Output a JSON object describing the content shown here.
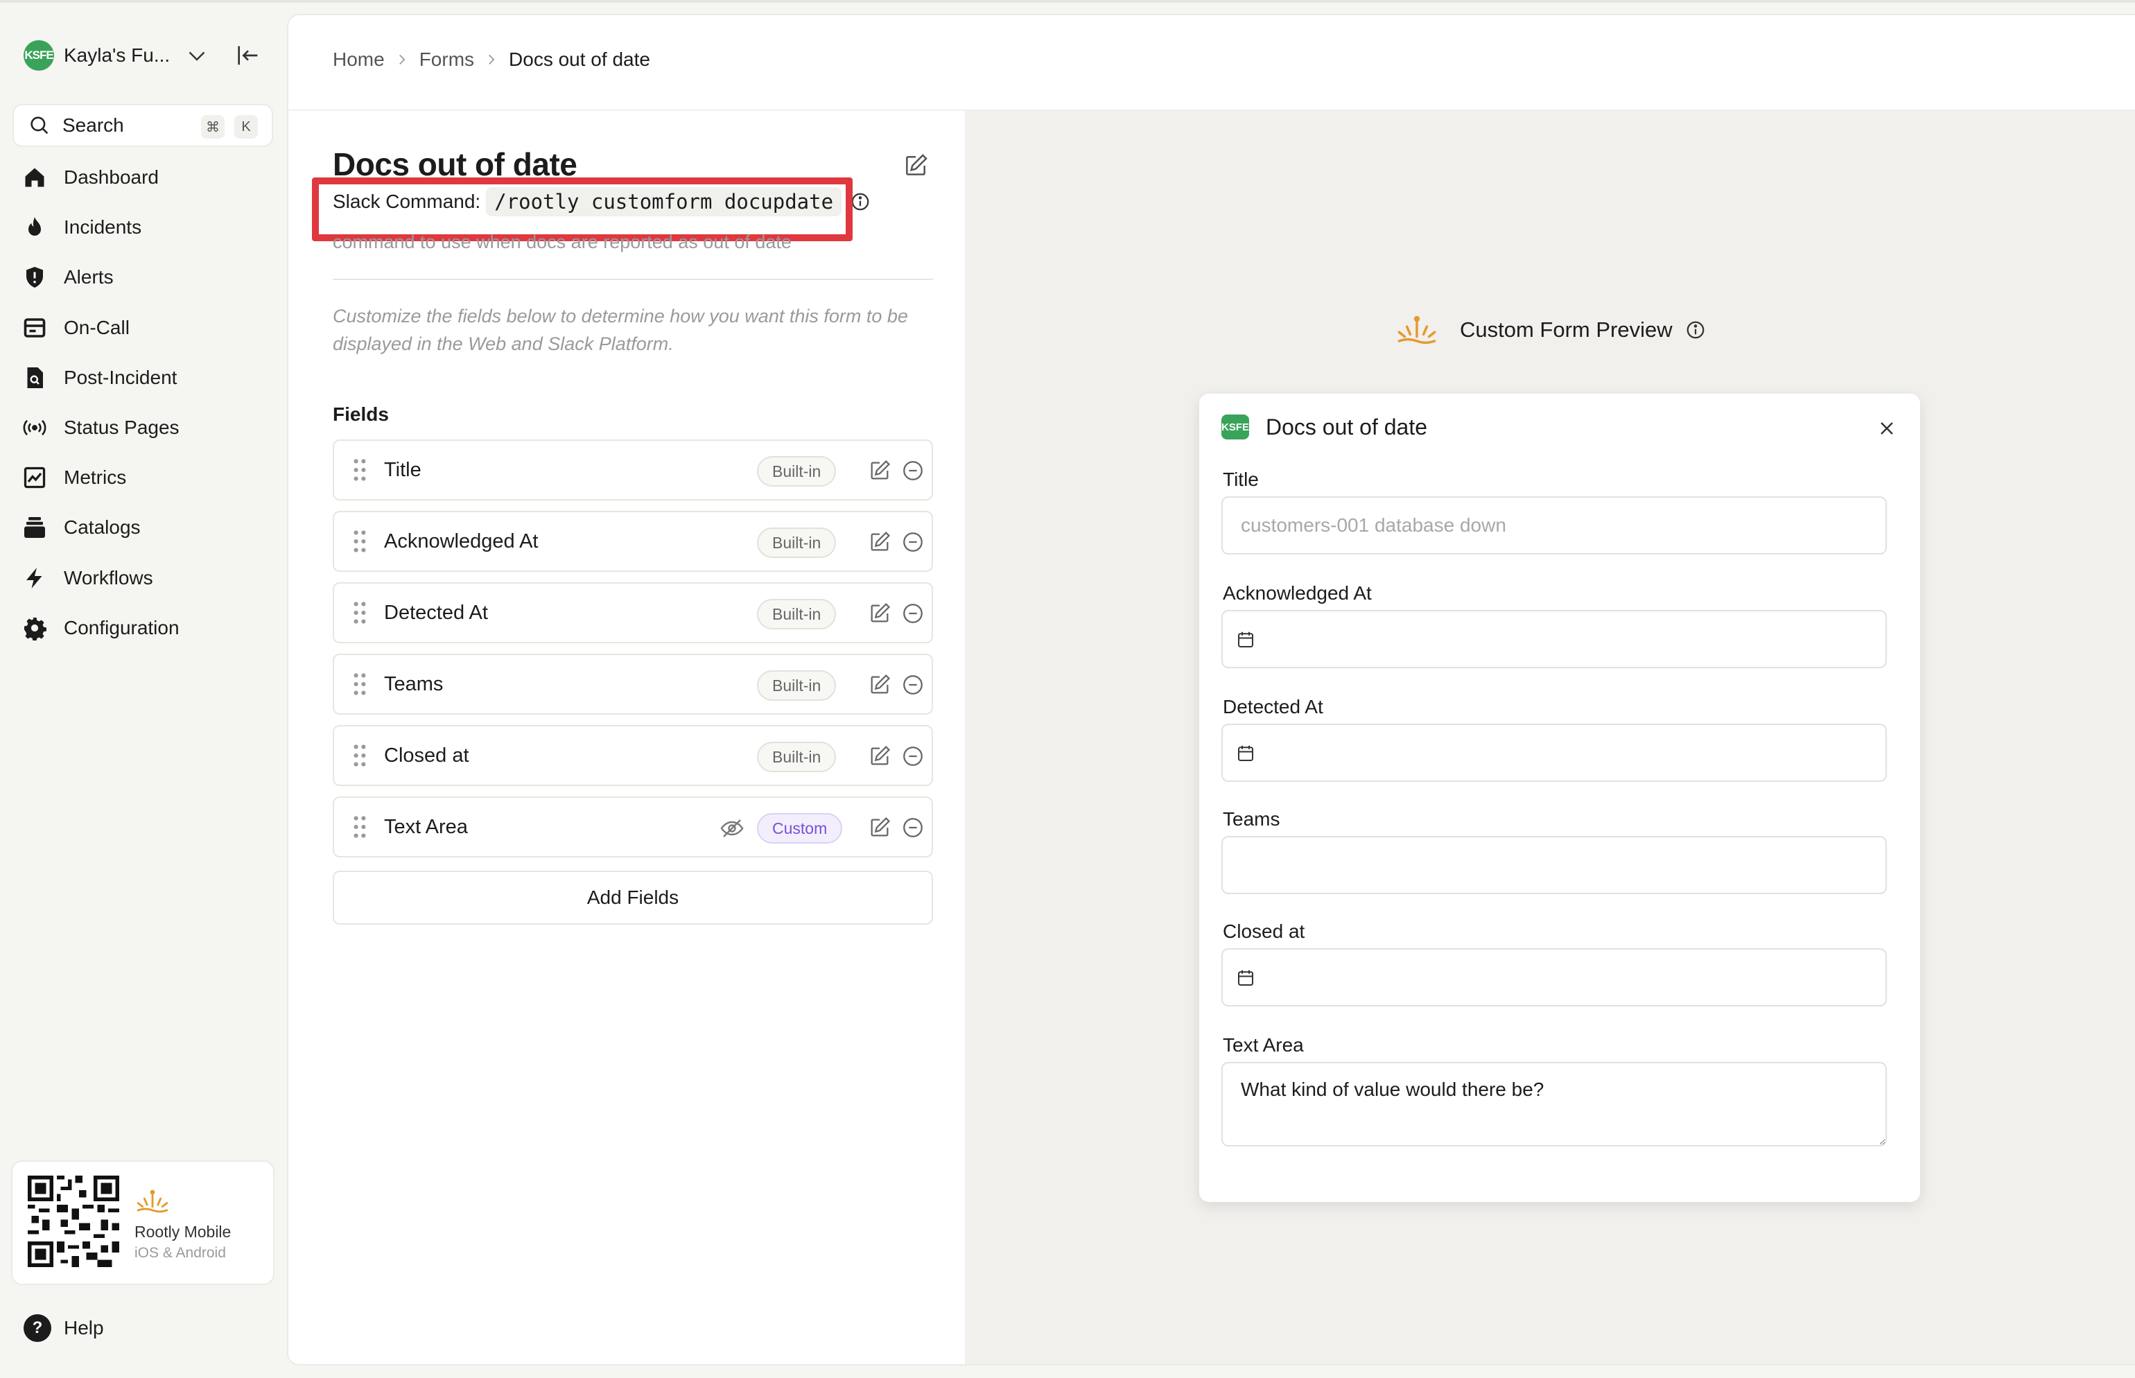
{
  "workspace": {
    "avatar": "KSFE",
    "name": "Kayla's Fu..."
  },
  "search": {
    "label": "Search",
    "kbd1": "⌘",
    "kbd2": "K"
  },
  "nav": [
    {
      "label": "Dashboard",
      "icon": "home-icon"
    },
    {
      "label": "Incidents",
      "icon": "flame-icon"
    },
    {
      "label": "Alerts",
      "icon": "shield-alert-icon"
    },
    {
      "label": "On-Call",
      "icon": "calendar-icon"
    },
    {
      "label": "Post-Incident",
      "icon": "document-search-icon"
    },
    {
      "label": "Status Pages",
      "icon": "broadcast-icon"
    },
    {
      "label": "Metrics",
      "icon": "chart-icon"
    },
    {
      "label": "Catalogs",
      "icon": "stack-icon"
    },
    {
      "label": "Workflows",
      "icon": "bolt-icon"
    },
    {
      "label": "Configuration",
      "icon": "gear-icon"
    }
  ],
  "mobile": {
    "title": "Rootly Mobile",
    "subtitle": "iOS & Android"
  },
  "help": {
    "label": "Help"
  },
  "breadcrumb": {
    "home": "Home",
    "forms": "Forms",
    "current": "Docs out of date"
  },
  "form": {
    "title": "Docs out of date",
    "slack_label": "Slack Command:",
    "slack_command": "/rootly customform docupdate",
    "description": "command to use when docs are reported as out of date",
    "help_text": "Customize the fields below to determine how you want this form to be displayed in the Web and Slack Platform.",
    "fields_label": "Fields",
    "fields": [
      {
        "name": "Title",
        "badge": "Built-in"
      },
      {
        "name": "Acknowledged At",
        "badge": "Built-in"
      },
      {
        "name": "Detected At",
        "badge": "Built-in"
      },
      {
        "name": "Teams",
        "badge": "Built-in"
      },
      {
        "name": "Closed at",
        "badge": "Built-in"
      },
      {
        "name": "Text Area",
        "badge": "Custom"
      }
    ],
    "add_fields": "Add Fields"
  },
  "preview": {
    "heading": "Custom Form Preview",
    "modal_avatar": "KSFE",
    "modal_title": "Docs out of date",
    "title_label": "Title",
    "title_placeholder": "customers-001 database down",
    "ack_label": "Acknowledged At",
    "detected_label": "Detected At",
    "teams_label": "Teams",
    "closed_label": "Closed at",
    "textarea_label": "Text Area",
    "textarea_value": "What kind of value would there be?"
  },
  "colors": {
    "highlight": "#e0383f",
    "brand": "#e49a2c",
    "workspace": "#3aa35a",
    "custom_badge": "#7b4fd6"
  }
}
